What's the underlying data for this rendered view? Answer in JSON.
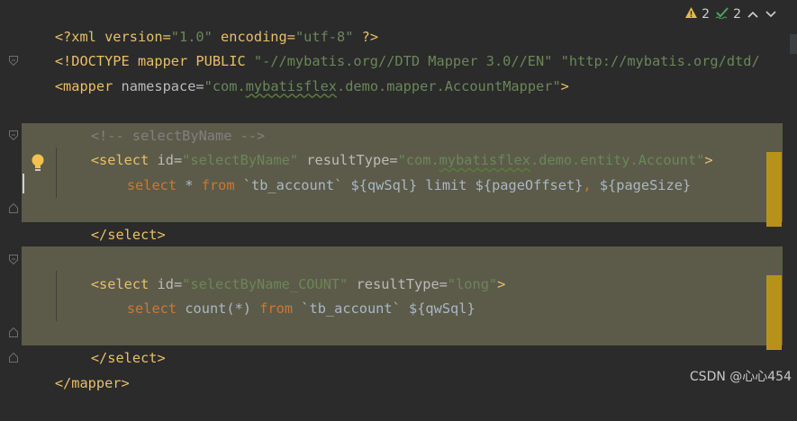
{
  "status": {
    "warnings": "2",
    "typos": "2",
    "warning_color": "#e6b94a",
    "typo_color": "#4fa15b"
  },
  "code": {
    "l1": {
      "a": "<?xml version=",
      "b": "\"1.0\"",
      "c": " encoding=",
      "d": "\"utf-8\"",
      "e": " ?>"
    },
    "l2": {
      "a": "<!DOCTYPE mapper PUBLIC ",
      "b": "\"-//mybatis.org//DTD Mapper 3.0//EN\"",
      "c": " ",
      "d": "\"http://mybatis.org/dtd/"
    },
    "l3": {
      "a": "<mapper",
      "b": " namespace=",
      "c": "\"com.",
      "d": "mybatisflex",
      "e": ".demo.mapper.AccountMapper\"",
      "f": ">"
    },
    "l5": {
      "a": "<!-- selectByName -->"
    },
    "l6": {
      "a": "<select",
      "b": " id=",
      "c": "\"selectByName\"",
      "d": " resultType=",
      "e": "\"com.",
      "f": "mybatisflex",
      "g": ".demo.entity.Account\"",
      "h": ">"
    },
    "l7": {
      "a": "select",
      "b": " * ",
      "c": "from",
      "d": " `tb_account` ${qwSql} limit ${pageOffset}",
      "e": ",",
      "f": " ${pageSize}"
    },
    "l9": {
      "a": "</select>"
    },
    "l11": {
      "a": "<select",
      "b": " id=",
      "c": "\"selectByName_COUNT\"",
      "d": " resultType=",
      "e": "\"long\"",
      "f": ">"
    },
    "l12": {
      "a": "select",
      "b": " count(*) ",
      "c": "from",
      "d": " `tb_account` ${qwSql}"
    },
    "l14": {
      "a": "</select>"
    },
    "l15": {
      "a": "</mapper>"
    }
  },
  "icons": {
    "warning": "warning-triangle-icon",
    "typo": "typo-check-icon",
    "bulb": "lightbulb-icon"
  },
  "watermark": "CSDN @心心454"
}
